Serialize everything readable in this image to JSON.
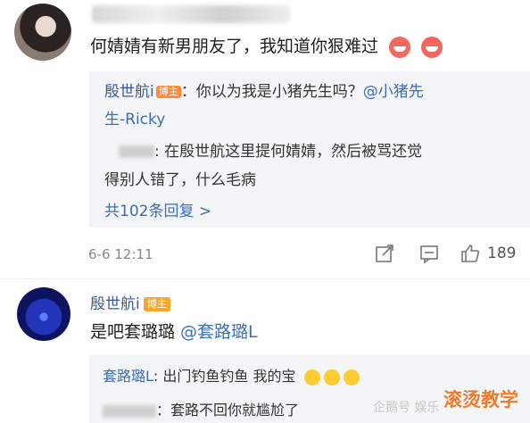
{
  "comment1": {
    "text": "何婧婧有新男朋友了，我知道你狠难过",
    "reply": {
      "author": "殷世航i",
      "author_badge": "博主",
      "line1": "：你以为我是小猪先生吗？",
      "mention1": "@小猪先",
      "mention2": "生-Ricky",
      "nested_text1": ": 在殷世航这里提何婧婧，然后被骂还觉",
      "nested_text2": "得别人错了，什么毛病"
    },
    "more_replies": "共102条回复 >",
    "time": "6-6 12:11",
    "like_count": "189"
  },
  "comment2": {
    "author": "殷世航i",
    "author_badge": "博主",
    "text_prefix": "是吧套璐璐 ",
    "mention": "@套路璐L",
    "reply1_author": "套路璐L",
    "reply1_text": ": 出门钓鱼钓鱼 我的宝",
    "reply2_text": "：套路不回你就尴尬了"
  },
  "overlay": {
    "watermark": "企鹅号 娱乐",
    "brand": "滚烫教学"
  },
  "colors": {
    "link": "#3b6db3",
    "badge": "#ff8a3d",
    "brand": "#f07a2a"
  }
}
